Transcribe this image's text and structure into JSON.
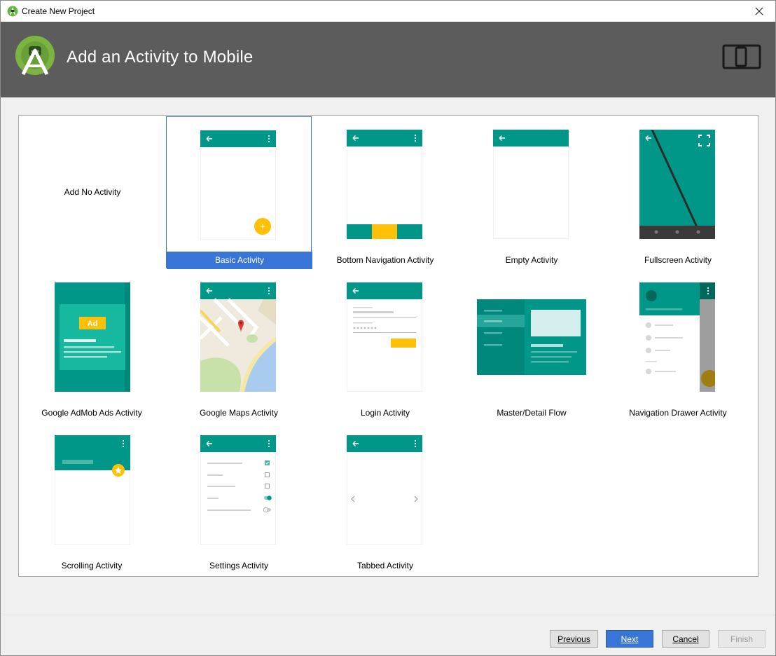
{
  "window": {
    "title": "Create New Project"
  },
  "header": {
    "title": "Add an Activity to Mobile"
  },
  "activities": [
    {
      "label": "Add No Activity"
    },
    {
      "label": "Basic Activity"
    },
    {
      "label": "Bottom Navigation Activity"
    },
    {
      "label": "Empty Activity"
    },
    {
      "label": "Fullscreen Activity"
    },
    {
      "label": "Google AdMob Ads Activity"
    },
    {
      "label": "Google Maps Activity"
    },
    {
      "label": "Login Activity"
    },
    {
      "label": "Master/Detail Flow"
    },
    {
      "label": "Navigation Drawer Activity"
    },
    {
      "label": "Scrolling Activity"
    },
    {
      "label": "Settings Activity"
    },
    {
      "label": "Tabbed Activity"
    }
  ],
  "admob": {
    "badge": "Ad"
  },
  "buttons": {
    "previous": "Previous",
    "next": "Next",
    "cancel": "Cancel",
    "finish": "Finish"
  },
  "colors": {
    "teal": "#009688",
    "teal_dark": "#00796b",
    "amber": "#ffc107",
    "selection": "#3875d7",
    "header": "#5c5c5c"
  }
}
